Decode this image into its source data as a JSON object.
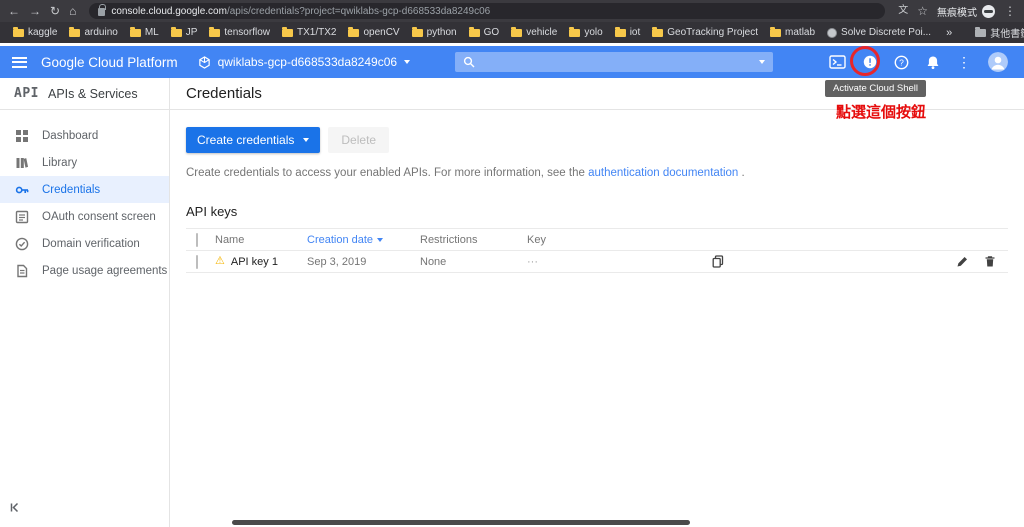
{
  "browser": {
    "address": {
      "domain": "console.cloud.google.com",
      "path": "/apis/credentials?project=qwiklabs-gcp-d668533da8249c06"
    },
    "incognito_label": "無痕模式",
    "bookmarks": [
      "kaggle",
      "arduino",
      "ML",
      "JP",
      "tensorflow",
      "TX1/TX2",
      "openCV",
      "python",
      "GO",
      "vehicle",
      "yolo",
      "iot",
      "GeoTracking Project",
      "matlab",
      "Solve Discrete Poi..."
    ],
    "other_bookmarks_label": "其他書籤"
  },
  "gcp": {
    "brand": "Google Cloud Platform",
    "project_name": "qwiklabs-gcp-d668533da8249c06",
    "cloud_shell_tooltip": "Activate Cloud Shell",
    "annotation_text": "點選這個按鈕"
  },
  "sidebar": {
    "logo_text": "API",
    "title": "APIs & Services",
    "items": [
      {
        "label": "Dashboard"
      },
      {
        "label": "Library"
      },
      {
        "label": "Credentials"
      },
      {
        "label": "OAuth consent screen"
      },
      {
        "label": "Domain verification"
      },
      {
        "label": "Page usage agreements"
      }
    ]
  },
  "main": {
    "page_title": "Credentials",
    "create_button_label": "Create credentials",
    "delete_button_label": "Delete",
    "description_text": "Create credentials to access your enabled APIs. For more information, see the",
    "description_link": "authentication documentation",
    "description_suffix": ".",
    "api_keys": {
      "heading": "API keys",
      "columns": {
        "name": "Name",
        "creation_date": "Creation date",
        "restrictions": "Restrictions",
        "key": "Key"
      },
      "rows": [
        {
          "name": "API key 1",
          "creation_date": "Sep 3, 2019",
          "restrictions": "None",
          "key": "···"
        }
      ]
    }
  },
  "colors": {
    "gcp_blue": "#4285f4",
    "accent_blue": "#1a73e8",
    "active_item_bg": "#e8f0fe",
    "annotation_red": "#e60c0c",
    "folder_yellow": "#f7c84a",
    "warning_yellow": "#f4b400"
  }
}
